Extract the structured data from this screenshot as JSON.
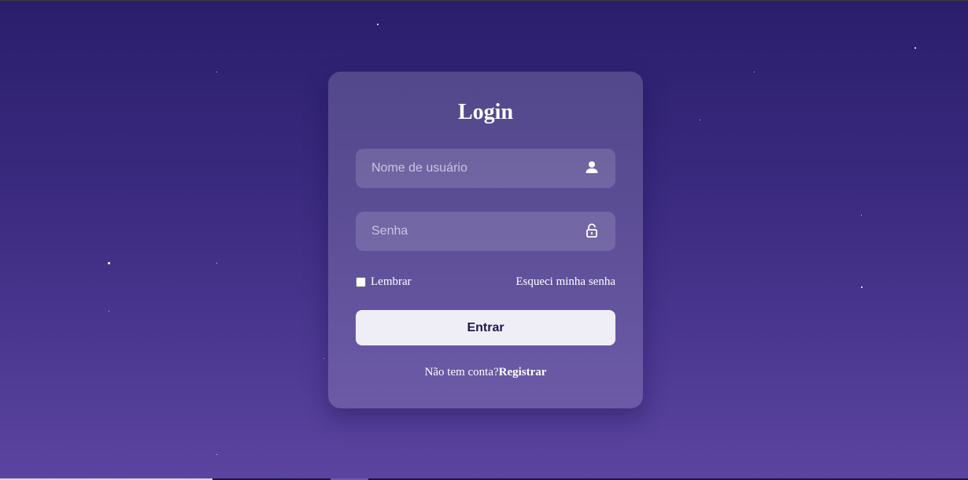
{
  "login": {
    "title": "Login",
    "username": {
      "placeholder": "Nome de usuário",
      "value": "",
      "icon": "user-icon"
    },
    "password": {
      "placeholder": "Senha",
      "value": "",
      "icon": "lock-icon"
    },
    "remember_label": "Lembrar",
    "remember_checked": false,
    "forgot_label": "Esqueci minha senha",
    "submit_label": "Entrar",
    "register_prompt": "Não tem conta?",
    "register_label": "Registrar"
  },
  "colors": {
    "background_top": "#2a1e6c",
    "background_bottom": "#5b44a0",
    "button_bg": "#efeef6",
    "button_text": "#1f164f"
  }
}
